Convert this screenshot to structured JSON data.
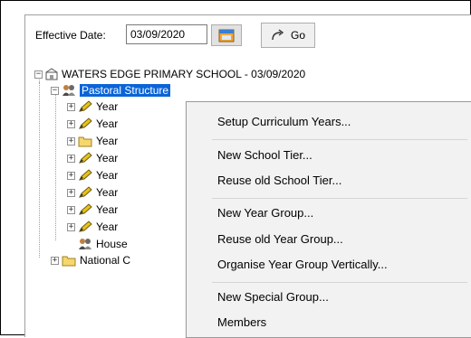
{
  "toolbar": {
    "effective_date_label": "Effective Date:",
    "effective_date_value": "03/09/2020",
    "go_label": "Go"
  },
  "tree": {
    "root": "WATERS EDGE PRIMARY SCHOOL - 03/09/2020",
    "pastoral": "Pastoral Structure",
    "year_items": [
      "Year",
      "Year",
      "Year",
      "Year",
      "Year",
      "Year",
      "Year",
      "Year"
    ],
    "house": "House",
    "national": "National C"
  },
  "menu": {
    "items": [
      "Setup Curriculum Years...",
      "New School Tier...",
      "Reuse old School Tier...",
      "New Year Group...",
      "Reuse old Year Group...",
      "Organise Year Group Vertically...",
      "New Special Group...",
      "Members"
    ]
  },
  "colors": {
    "selection": "#0a64d7",
    "menu_bg": "#f2f2f2",
    "folder_yellow": "#f5d76e",
    "pencil_yellow": "#e8c21a"
  }
}
